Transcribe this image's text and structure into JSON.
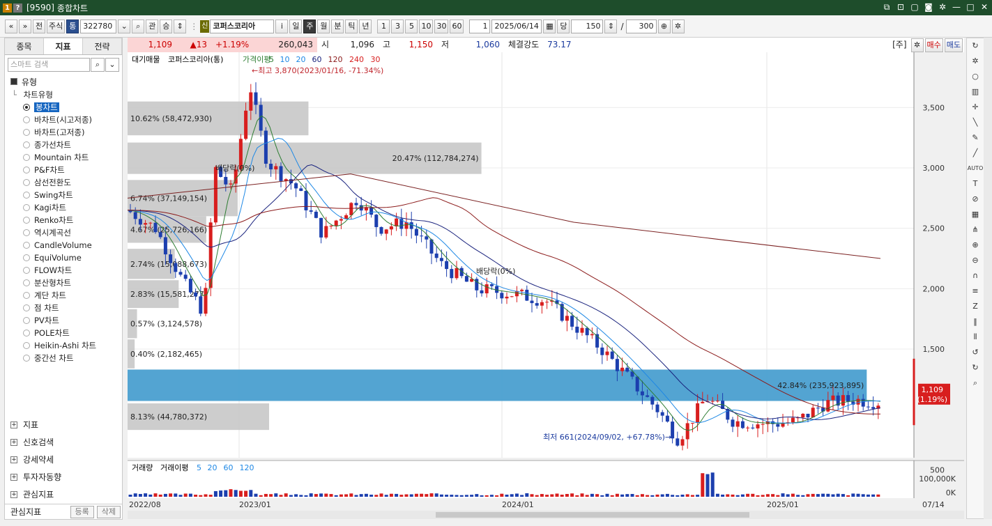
{
  "titlebar": {
    "code": "[9590]",
    "title": "종합차트",
    "icon1": "1",
    "icon2": "?"
  },
  "toolbar": {
    "nav_prev": "«",
    "nav_down": "»",
    "front_label": "전",
    "type_label": "주식",
    "tong_label": "통",
    "code_value": "322780",
    "kwan_label": "관",
    "sung_label": "승",
    "new_badge": "신",
    "stock_name": "코퍼스코리아",
    "info_label": "i",
    "periods": [
      "일",
      "주",
      "월",
      "분",
      "틱",
      "년"
    ],
    "intervals": [
      "1",
      "3",
      "5",
      "10",
      "30",
      "60"
    ],
    "unit_value": "1",
    "date_value": "2025/06/14",
    "dang_label": "당",
    "count_value": "150",
    "slash": "/",
    "total_value": "300"
  },
  "left": {
    "tabs": [
      "종목",
      "지표",
      "전략"
    ],
    "search_placeholder": "스마트 검색",
    "section_type": "유형",
    "tree_header": "차트유형",
    "chart_types": [
      "봉차트",
      "바차트(시고저종)",
      "바차트(고저종)",
      "종가선차트",
      "Mountain 차트",
      "P&F차트",
      "삼선전환도",
      "Swing차트",
      "Kagi차트",
      "Renko차트",
      "역시계곡선",
      "CandleVolume",
      "EquiVolume",
      "FLOW차트",
      "분산형차트",
      "계단 차트",
      "점 차트",
      "PV차트",
      "POLE차트",
      "Heikin-Ashi 차트",
      "중간선 차트"
    ],
    "bottom_sections": [
      "지표",
      "신호검색",
      "강세약세",
      "투자자동향",
      "관심지표"
    ],
    "fav_label": "관심지표",
    "fav_add": "등록",
    "fav_del": "삭제"
  },
  "quote": {
    "price": "1,109",
    "change": "▲13",
    "pct": "+1.19%",
    "volume": "260,043",
    "open_label": "시",
    "open": "1,096",
    "high_label": "고",
    "high": "1,150",
    "low_label": "저",
    "low": "1,060",
    "strength_label": "체결강도",
    "strength": "73.17",
    "ju_label": "[주]",
    "buy_label": "매수",
    "sell_label": "매도"
  },
  "chart_data": {
    "type": "candlestick",
    "legend_main": [
      "대기매물",
      "코퍼스코리아(통)",
      "가격이평",
      "5",
      "10",
      "20",
      "60",
      "120",
      "240",
      "30"
    ],
    "legend_volume": [
      "거래량",
      "거래이평",
      "5",
      "20",
      "60",
      "120"
    ],
    "y_ticks": [
      3500,
      3000,
      2500,
      2000,
      1500,
      500
    ],
    "y_tick_labels": [
      "3,500",
      "3,000",
      "2,500",
      "2,000",
      "1,500",
      "500"
    ],
    "ylim": [
      600,
      3900
    ],
    "x_tick_labels": [
      "2022/08",
      "2023/01",
      "2024/01",
      "2025/01",
      "07/14"
    ],
    "volume_ticks": [
      "100,000K",
      "0K"
    ],
    "high_annotation": "←최고 3,870(2023/01/16, -71.34%)",
    "low_annotation": "최저 661(2024/09/02, +67.78%)→",
    "dividend_labels": [
      "배당락(0%)",
      "배당락(0%)"
    ],
    "current_price_label": "1,109",
    "current_pct_label": "(1.19%)",
    "supply_bands": [
      {
        "low": 3270,
        "high": 3550,
        "pct": "10.62%",
        "vol": "(58,472,930)",
        "rel_len": 0.23
      },
      {
        "low": 2950,
        "high": 3210,
        "pct": "20.47%",
        "vol": "(112,784,274)",
        "rel_len": 0.45
      },
      {
        "low": 2600,
        "high": 2900,
        "pct": "6.74%",
        "vol": "(37,149,154)",
        "rel_len": 0.14
      },
      {
        "low": 2380,
        "high": 2600,
        "pct": "4.67%",
        "vol": "(25,726,166)",
        "rel_len": 0.1
      },
      {
        "low": 2080,
        "high": 2330,
        "pct": "2.74%",
        "vol": "(15,088,673)",
        "rel_len": 0.06
      },
      {
        "low": 1840,
        "high": 2070,
        "pct": "2.83%",
        "vol": "(15,581,277)",
        "rel_len": 0.065
      },
      {
        "low": 1590,
        "high": 1830,
        "pct": "0.57%",
        "vol": "(3,124,578)",
        "rel_len": 0.012
      },
      {
        "low": 1340,
        "high": 1580,
        "pct": "0.40%",
        "vol": "(2,182,465)",
        "rel_len": 0.009
      },
      {
        "low": 1070,
        "high": 1330,
        "pct": "42.84%",
        "vol": "(235,923,895)",
        "rel_len": 0.94,
        "highlight": true
      },
      {
        "low": 830,
        "high": 1050,
        "pct": "8.13%",
        "vol": "(44,780,372)",
        "rel_len": 0.18
      }
    ],
    "series_colors": {
      "up": "#d81e1e",
      "down": "#1c3fae",
      "ma5": "#2e7d32",
      "ma10": "#1e88e5",
      "ma20": "#1a237e",
      "ma60": "#8b1a1a",
      "ma120": "#7a2020",
      "highlight_band": "#4a9fd0",
      "band": "#c8c8c8"
    }
  },
  "right_tools": [
    "refresh-icon",
    "settings-icon",
    "circle-icon",
    "bar-icon",
    "cross-icon",
    "line-icon",
    "zoom-icon",
    "text-icon",
    "auto-icon"
  ]
}
